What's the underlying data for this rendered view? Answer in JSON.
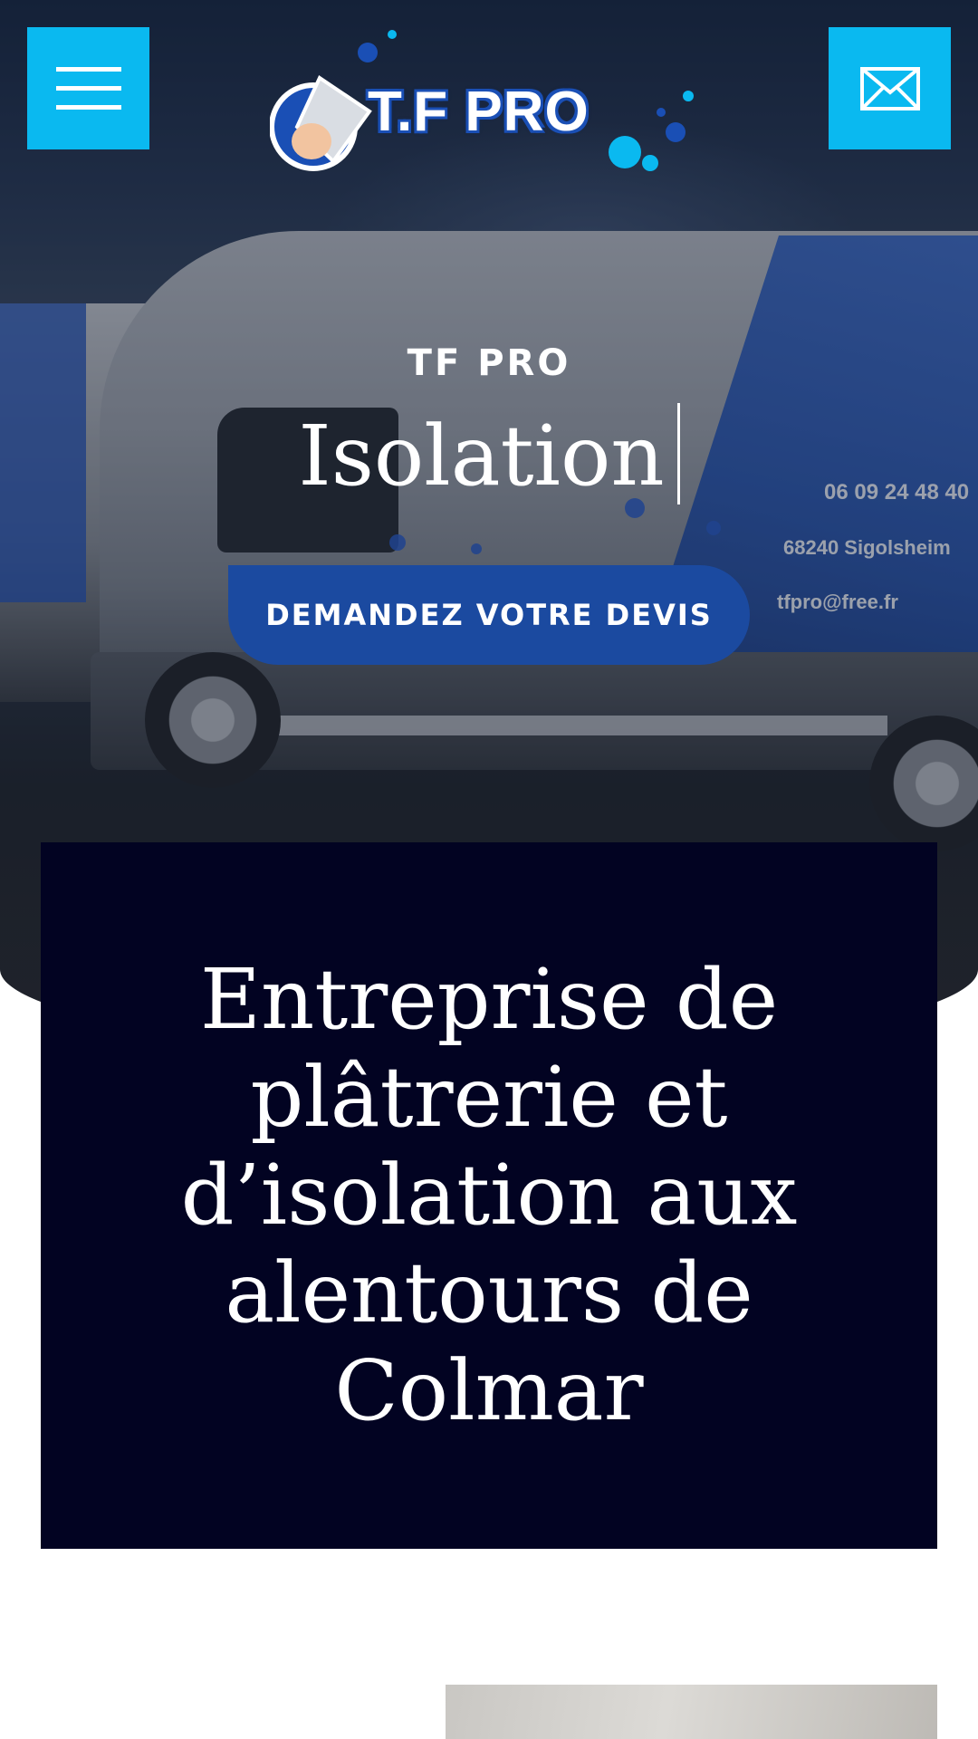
{
  "header": {
    "menu_icon": "hamburger-menu-icon",
    "mail_icon": "envelope-icon",
    "logo_text": "T.F PRO",
    "button_color": "#0ab9f0"
  },
  "hero": {
    "kicker": "TF PRO",
    "rotating_title": "Isolation",
    "cta_label": "DEMANDEZ VOTRE DEVIS",
    "cta_color": "#1b4aa0",
    "van_texts": {
      "phone": "06 09 24 48 40",
      "city": "68240 Sigolsheim",
      "email": "tfpro@free.fr"
    }
  },
  "intro": {
    "heading": "Entreprise de plâtrerie et d’isolation aux alentours de Colmar",
    "background": "#020322"
  }
}
